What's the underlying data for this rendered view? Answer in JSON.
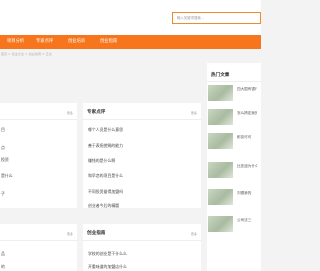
{
  "search": {
    "placeholder": "输入关键词搜索..."
  },
  "nav": {
    "items": [
      "项目分析",
      "专家点评",
      "创业培训",
      "创业指南"
    ]
  },
  "breadcrumb": {
    "text": "首页 > 创业大全 > 创业指南 > 正文"
  },
  "left_panel_top": {
    "more": "更多",
    "items": [
      "目",
      "点",
      "投资",
      "是什么",
      "子"
    ]
  },
  "left_panel_bottom": {
    "more": "更多",
    "items": [
      "品",
      "的"
    ]
  },
  "expert_panel": {
    "title": "专家点评",
    "more": "更多",
    "items": [
      "哪个人员是什么意思",
      "善于表扬赏赐的能力",
      "赚钱的是什么啊",
      "和早恋的项目是什么",
      "不同投资量得加盟吗",
      "创业者今后的精髓"
    ]
  },
  "guide_panel": {
    "title": "创业指南",
    "more": "更多",
    "items": [
      "学校的创业是干什么么",
      "开重味道的加盟店什么"
    ]
  },
  "hot_panel": {
    "title": "热门文章",
    "items": [
      "四大国有银行",
      "怎么搞定我的 不满",
      "耐克可可",
      "比亚迪为什么要 入职",
      "刘德我的",
      "公司法三"
    ]
  }
}
